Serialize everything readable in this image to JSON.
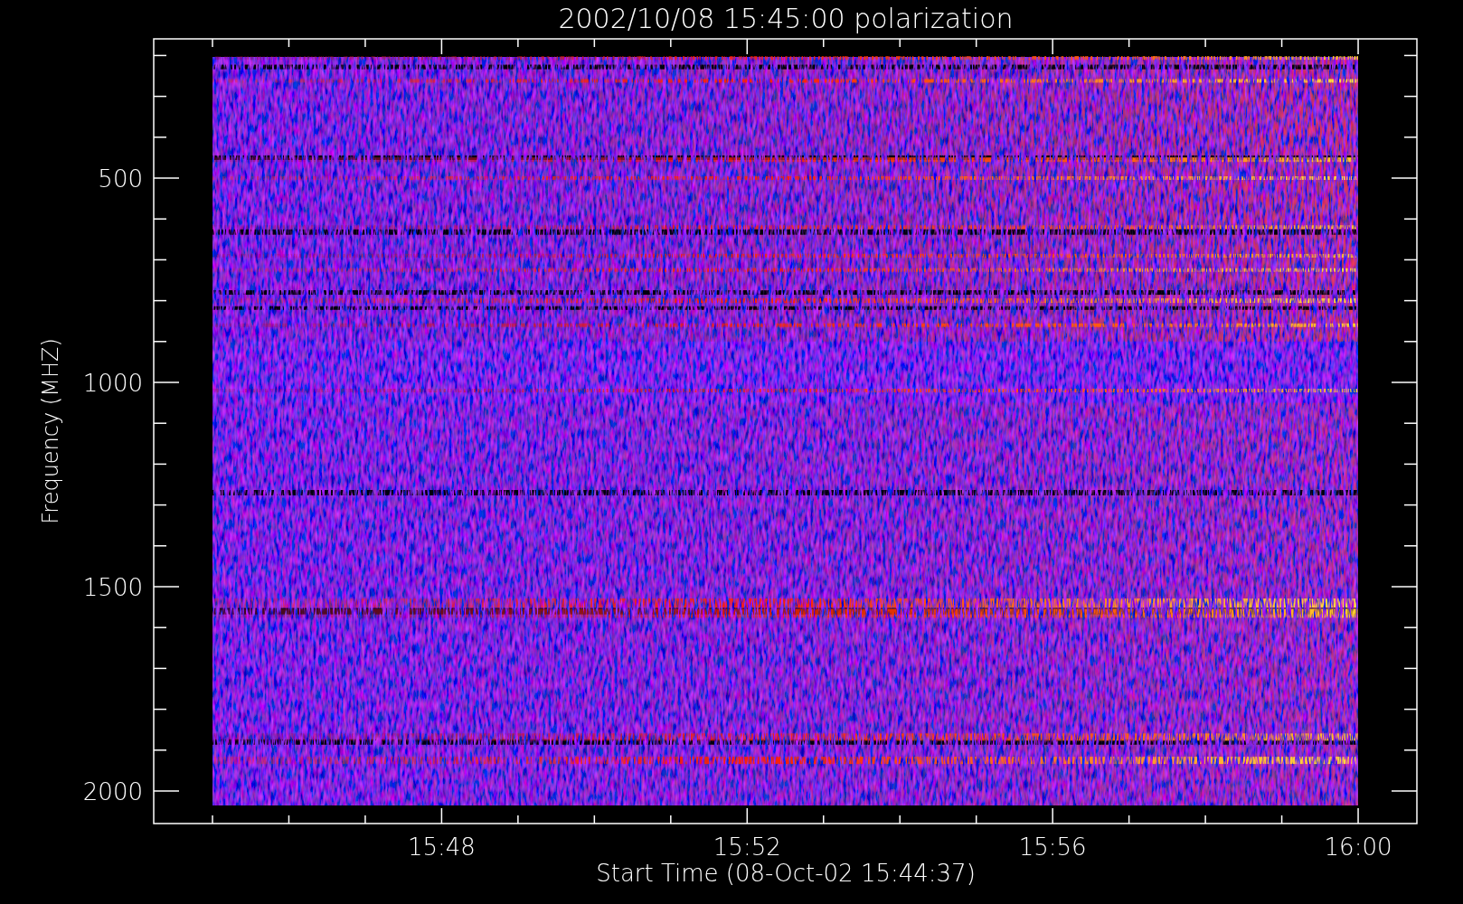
{
  "title": "2002/10/08 15:45:00 polarization",
  "ylabel": "Frequency (MHZ)",
  "xlabel": "Start Time (08-Oct-02 15:44:37)",
  "yticks": [
    "500",
    "1000",
    "1500",
    "2000"
  ],
  "xticks": [
    "15:48",
    "15:52",
    "15:56",
    "16:00"
  ]
}
